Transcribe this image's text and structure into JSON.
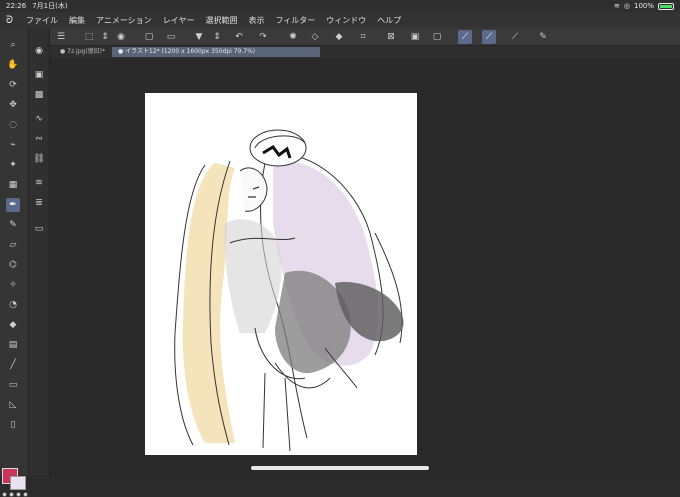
{
  "status": {
    "time": "22:26",
    "date": "7月1日(木)",
    "battery": "100%"
  },
  "menu": [
    "ファイル",
    "編集",
    "アニメーション",
    "レイヤー",
    "選択範囲",
    "表示",
    "フィルター",
    "ウィンドウ",
    "ヘルプ"
  ],
  "tabs": [
    {
      "label": "7z.jpg(復旧)*",
      "active": false
    },
    {
      "label": "イラスト12* (1200 x 1600px 350dpi 79.7%)",
      "active": true
    }
  ],
  "colors": {
    "main": "#c8345a",
    "sub": "#e9e0f0",
    "accent": "#5b6a8c"
  },
  "toolbar_icons": [
    "menu-icon",
    "transform-icon",
    "stepper-icon",
    "eye-icon",
    "new-file-icon",
    "open-folder-icon",
    "save-icon",
    "stepper-icon",
    "undo-icon",
    "redo-icon",
    "spinner-icon",
    "clear-icon",
    "fill-icon",
    "crop-icon",
    "select-off-icon",
    "select-invert-icon",
    "select-border-icon",
    "pen-stabilize-icon",
    "pen-taper-icon",
    "pen-ruler-icon",
    "vector-icon"
  ],
  "left_tools": [
    "magnifier-icon",
    "hand-icon",
    "rotate-icon",
    "move-icon",
    "lasso-icon",
    "eyedropper-icon",
    "wand-icon",
    "frame-icon",
    "pen-icon",
    "pencil-icon",
    "eraser-icon",
    "airbrush-icon",
    "blend-icon",
    "blur-icon",
    "fill-tool-icon",
    "gradient-icon",
    "line-icon",
    "ruler-icon",
    "text-icon",
    "balloon-icon"
  ],
  "sub_tools": [
    "brush-size-icon",
    "layer-icon",
    "shape-icon",
    "curve-icon",
    "add-curve-icon",
    "chain-icon",
    "layer-stack-icon",
    "layer-stack2-icon",
    "camera-icon"
  ]
}
